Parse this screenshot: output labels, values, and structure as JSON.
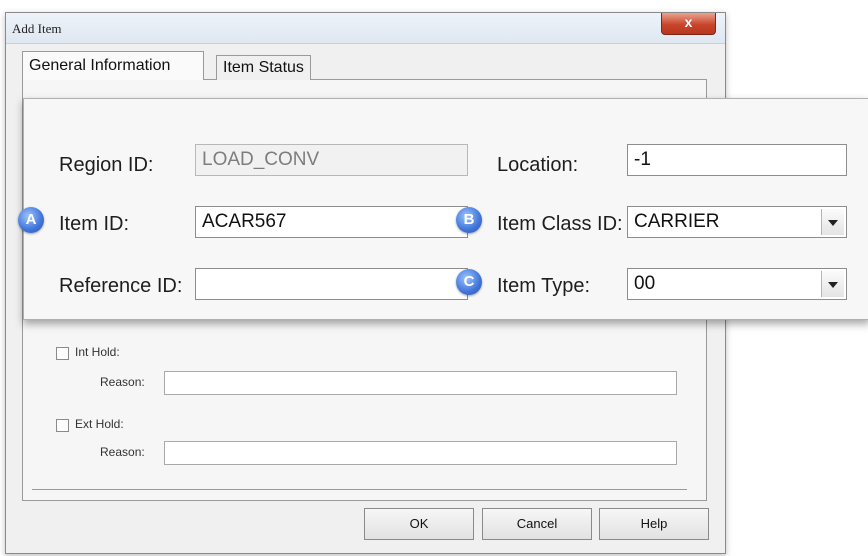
{
  "window": {
    "title": "Add Item",
    "close_glyph": "x"
  },
  "tabs": [
    {
      "label": "General Information"
    },
    {
      "label": "Item Status"
    }
  ],
  "form": {
    "region_id": {
      "label": "Region ID:",
      "value": "LOAD_CONV"
    },
    "location": {
      "label": "Location:",
      "value": "-1"
    },
    "item_id": {
      "label": "Item ID:",
      "value": "ACAR567",
      "badge": "A"
    },
    "item_class_id": {
      "label": "Item Class ID:",
      "value": "CARRIER",
      "badge": "B"
    },
    "reference_id": {
      "label": "Reference ID:",
      "value": ""
    },
    "item_type": {
      "label": "Item Type:",
      "value": "00",
      "badge": "C"
    }
  },
  "holds": {
    "int_hold": {
      "label": "Int Hold:",
      "reason_label": "Reason:",
      "reason_value": ""
    },
    "ext_hold": {
      "label": "Ext Hold:",
      "reason_label": "Reason:",
      "reason_value": ""
    }
  },
  "buttons": {
    "ok": "OK",
    "cancel": "Cancel",
    "help": "Help"
  },
  "colors": {
    "badge": "#3f74d8",
    "close": "#c9462d"
  }
}
